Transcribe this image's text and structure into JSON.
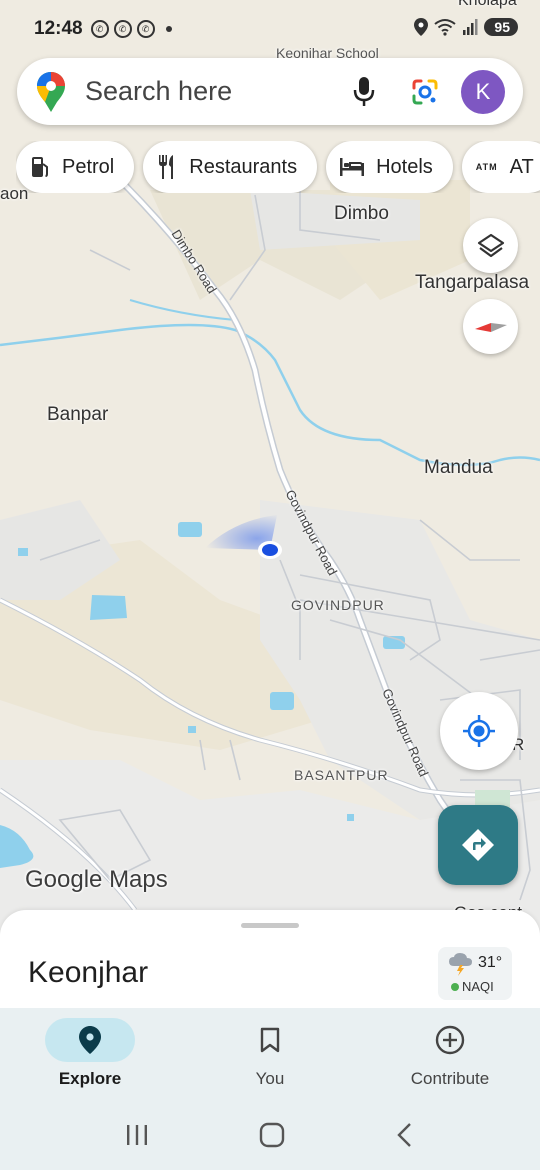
{
  "status_bar": {
    "time": "12:48",
    "battery": "95"
  },
  "search": {
    "placeholder": "Search here",
    "avatar_letter": "K"
  },
  "chips": [
    {
      "label": "Petrol",
      "icon": "fuel-icon"
    },
    {
      "label": "Restaurants",
      "icon": "restaurant-icon"
    },
    {
      "label": "Hotels",
      "icon": "hotel-icon"
    },
    {
      "label": "AT",
      "icon": "atm-icon"
    }
  ],
  "map": {
    "labels": {
      "keonjhar_school": "Keonjhar School",
      "kholapa": "Kholapa",
      "aon": "aon",
      "dimbo": "Dimbo",
      "tangarpalasa": "Tangarpalasa",
      "banpar": "Banpar",
      "mandua": "Mandua",
      "govindpur": "GOVINDPUR",
      "basantpur": "BASANTPUR",
      "gas_centre": "Gas cent",
      "cut_r": "R"
    },
    "roads": {
      "dimbo_road": "Dimbo Road",
      "govindpur_road_1": "Govindpur Road",
      "govindpur_road_2": "Govindpur Road"
    },
    "watermark_google": "Google",
    "watermark_maps": "Maps",
    "atm_glyph": "ATM"
  },
  "sheet": {
    "title": "Keonjhar",
    "temperature": "31°",
    "aqi_label": "NAQI"
  },
  "bottom_nav": [
    {
      "label": "Explore",
      "active": true
    },
    {
      "label": "You",
      "active": false
    },
    {
      "label": "Contribute",
      "active": false
    }
  ],
  "colors": {
    "accent": "#1a73e8",
    "directions_fab": "#2e7a86",
    "avatar": "#7e57c2",
    "nav_active_pill": "#c6e7f0",
    "map_land": "#efebe1",
    "water": "#8fd0ec"
  }
}
